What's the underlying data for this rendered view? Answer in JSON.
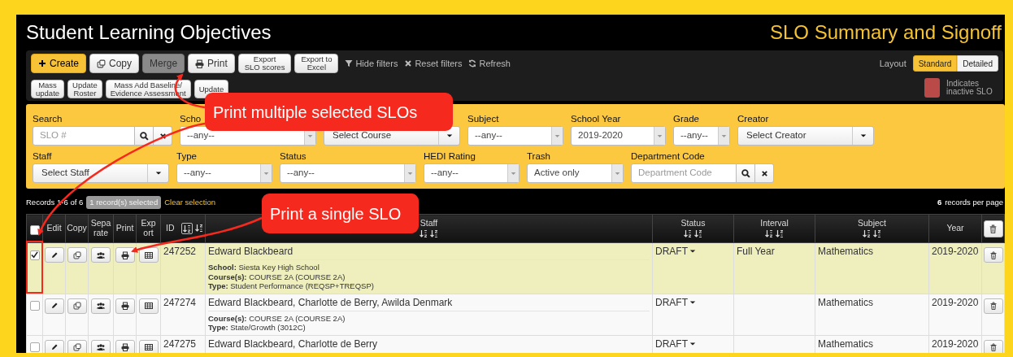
{
  "header": {
    "title": "Student Learning Objectives",
    "subtitle": "SLO Summary and Signoff"
  },
  "toolbar": {
    "buttons": [
      {
        "label": "Create",
        "kind": "primary"
      },
      {
        "label": "Copy",
        "kind": "default"
      },
      {
        "label": "Merge",
        "kind": "disabled"
      },
      {
        "label": "Print",
        "kind": "default"
      },
      {
        "label": "Export\nSLO scores",
        "kind": "small"
      },
      {
        "label": "Export to\nExcel",
        "kind": "small"
      }
    ],
    "links": [
      {
        "label": "Hide filters"
      },
      {
        "label": "Reset filters"
      },
      {
        "label": "Refresh"
      }
    ],
    "layout": {
      "label": "Layout",
      "options": [
        {
          "label": "Standard",
          "selected": true
        },
        {
          "label": "Detailed",
          "selected": false
        }
      ]
    },
    "buttons_row2": [
      "Mass\nupdate",
      "Update\nRoster",
      "Mass Add Baseline/\nEvidence Assessment",
      "Update"
    ],
    "legend": {
      "color": "#b94a48",
      "text": "Indicates inactive SLO"
    }
  },
  "filters": {
    "rows": [
      [
        {
          "label": "Search",
          "kind": "search",
          "placeholder": "SLO #"
        },
        {
          "label": "Scho",
          "kind": "select",
          "value": "--any--"
        },
        {
          "kind": "dropdown",
          "value": "Select Course"
        },
        {
          "label": "Subject",
          "kind": "select",
          "value": "--any--"
        },
        {
          "label": "School Year",
          "kind": "select",
          "value": "2019-2020"
        },
        {
          "label": "Grade",
          "kind": "select",
          "value": "--any--"
        },
        {
          "label": "Creator",
          "kind": "dropdown",
          "value": "Select Creator"
        }
      ],
      [
        {
          "label": "Staff",
          "kind": "dropdown",
          "value": "Select Staff"
        },
        {
          "label": "Type",
          "kind": "select",
          "value": "--any--"
        },
        {
          "label": "Status",
          "kind": "select",
          "value": "--any--"
        },
        {
          "label": "HEDI Rating",
          "kind": "select",
          "value": "--any--"
        },
        {
          "label": "Trash",
          "kind": "select",
          "value": "Active only"
        },
        {
          "label": "Department Code",
          "kind": "search",
          "placeholder": "Department Code"
        }
      ]
    ]
  },
  "records": {
    "summary": "Records 1-6 of 6",
    "selected_badge": "1 record(s) selected",
    "clear": "Clear selection",
    "per_page_count": "6",
    "per_page_label": "records per page"
  },
  "table": {
    "columns": [
      {
        "kind": "checkbox",
        "checked": false
      },
      {
        "kind": "text",
        "label": "Edit"
      },
      {
        "kind": "text",
        "label": "Copy"
      },
      {
        "kind": "text",
        "label": "Separate"
      },
      {
        "kind": "text",
        "label": "Print"
      },
      {
        "kind": "text",
        "label": "Export"
      },
      {
        "kind": "sortable",
        "label": "ID",
        "sorted": true
      },
      {
        "kind": "sortable",
        "label": "Staff",
        "sorted": false
      },
      {
        "kind": "sortable",
        "label": "Status",
        "sorted": false
      },
      {
        "kind": "sortable",
        "label": "Interval",
        "sorted": false
      },
      {
        "kind": "sortable",
        "label": "Subject",
        "sorted": false
      },
      {
        "kind": "text",
        "label": "Year"
      },
      {
        "kind": "trash"
      }
    ],
    "rows": [
      {
        "checked": true,
        "selected": true,
        "id": "247252",
        "staff": "Edward Blackbeard",
        "details": [
          {
            "label": "School:",
            "value": "Siesta Key High School"
          },
          {
            "label": "Course(s):",
            "value": "COURSE 2A (COURSE 2A)"
          },
          {
            "label": "Type:",
            "value": "Student Performance (REQSP+TREQSP)"
          }
        ],
        "status": "DRAFT",
        "interval": "Full Year",
        "subject": "Mathematics",
        "year": "2019-2020"
      },
      {
        "checked": false,
        "selected": false,
        "id": "247274",
        "staff": "Edward Blackbeard, Charlotte de Berry, Awilda Denmark",
        "details": [
          {
            "label": "Course(s):",
            "value": "COURSE 2A (COURSE 2A)"
          },
          {
            "label": "Type:",
            "value": "State/Growth (3012C)"
          }
        ],
        "status": "DRAFT",
        "subject": "Mathematics",
        "year": "2019-2020"
      },
      {
        "checked": false,
        "selected": false,
        "id": "247275",
        "staff": "Edward Blackbeard, Charlotte de Berry",
        "status": "DRAFT",
        "subject": "Mathematics",
        "year": "2019-2020"
      }
    ]
  },
  "annotations": [
    {
      "text": "Print multiple selected SLOs"
    },
    {
      "text": "Print a single SLO"
    }
  ]
}
